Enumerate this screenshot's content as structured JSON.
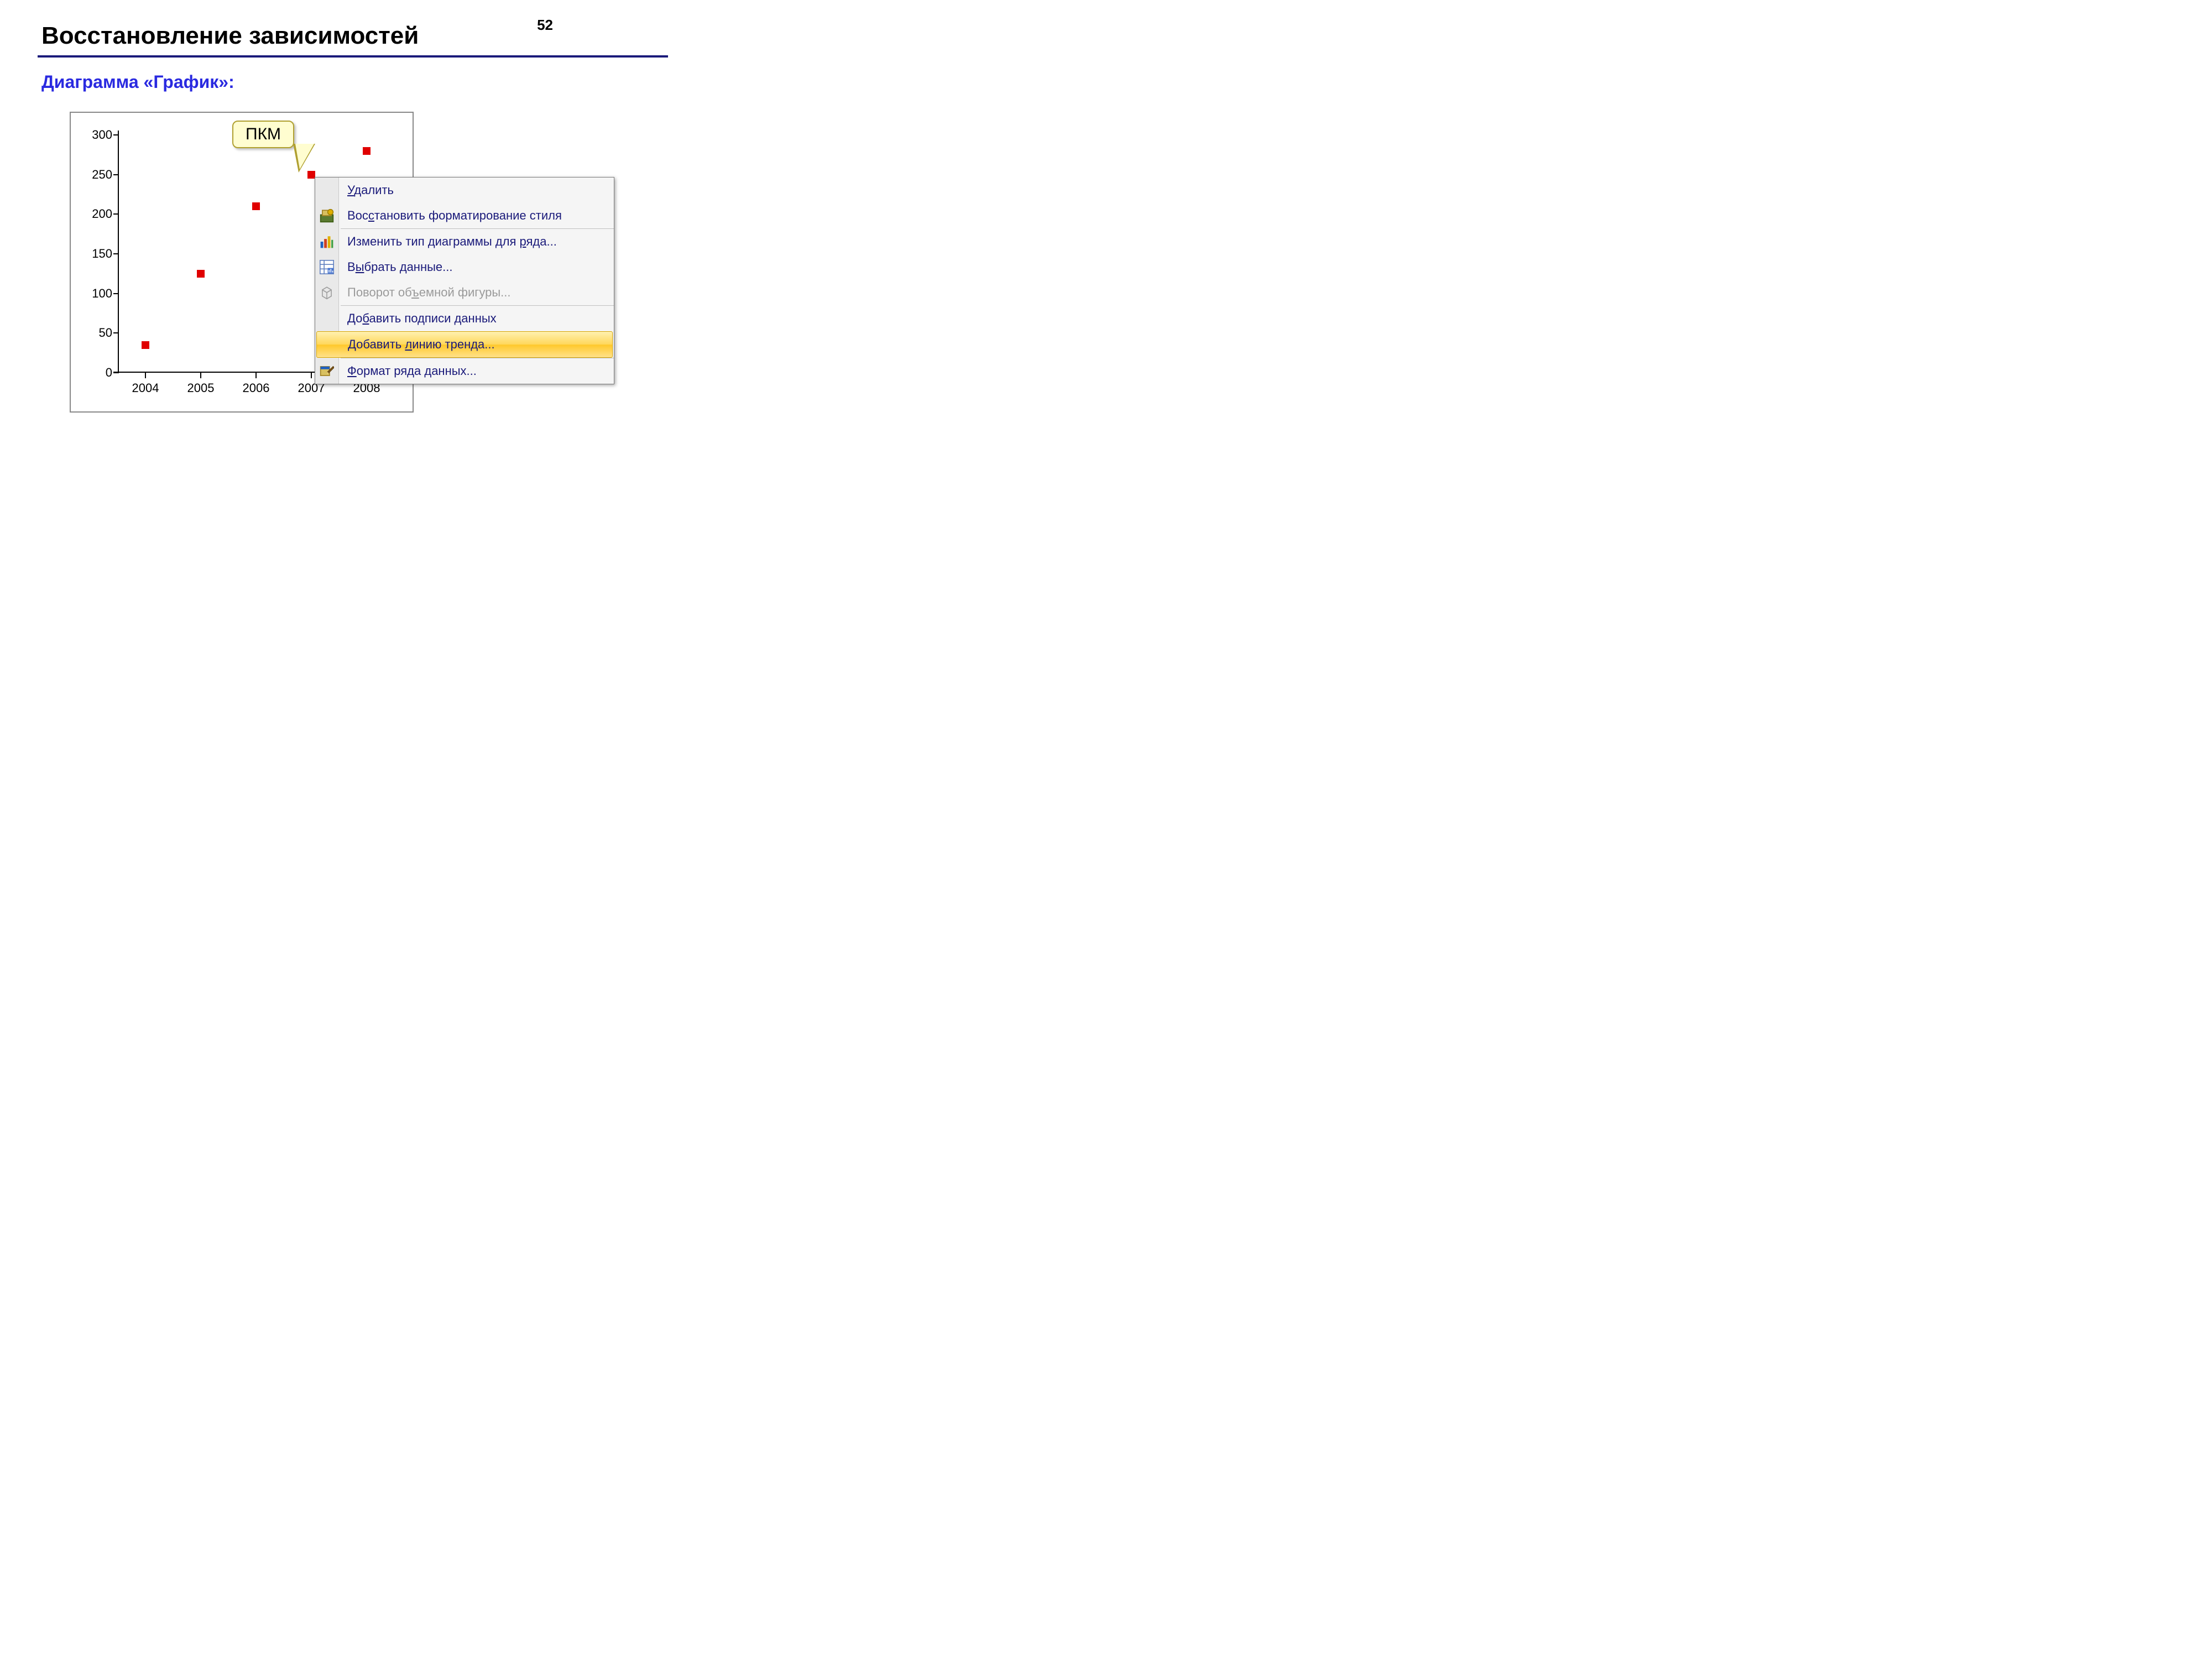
{
  "page_number": "52",
  "title": "Восстановление зависимостей",
  "subtitle": "Диаграмма «График»:",
  "callout_label": "ПКМ",
  "chart_data": {
    "type": "scatter",
    "x": [
      2004,
      2005,
      2006,
      2007,
      2008
    ],
    "y": [
      35,
      125,
      210,
      250,
      280
    ],
    "x_ticks": [
      2004,
      2005,
      2006,
      2007,
      2008
    ],
    "y_ticks": [
      0,
      50,
      100,
      150,
      200,
      250,
      300
    ],
    "xlim": [
      2003.5,
      2008.5
    ],
    "ylim": [
      0,
      300
    ],
    "title": "",
    "xlabel": "",
    "ylabel": "",
    "marker_color": "#e00000",
    "marker_shape": "square"
  },
  "context_menu": {
    "highlighted_index": 6,
    "items": [
      {
        "label": "Удалить",
        "underline_index": 0,
        "icon": null,
        "disabled": false
      },
      {
        "label": "Восстановить форматирование стиля",
        "underline_index": 3,
        "icon": "reset-style-icon",
        "disabled": false
      },
      {
        "label": "Изменить тип диаграммы для ряда...",
        "underline_index": 27,
        "icon": "chart-type-icon",
        "disabled": false
      },
      {
        "label": "Выбрать данные...",
        "underline_index": 1,
        "icon": "select-data-icon",
        "disabled": false
      },
      {
        "label": "Поворот объемной фигуры...",
        "underline_index": 10,
        "icon": "rotate-3d-icon",
        "disabled": true
      },
      {
        "label": "Добавить подписи данных",
        "underline_index": 2,
        "icon": null,
        "disabled": false
      },
      {
        "label": "Добавить линию тренда...",
        "underline_index": 9,
        "icon": null,
        "disabled": false
      },
      {
        "label": "Формат ряда данных...",
        "underline_index": 0,
        "icon": "format-series-icon",
        "disabled": false
      }
    ],
    "separators_after": [
      1,
      4,
      6
    ]
  }
}
